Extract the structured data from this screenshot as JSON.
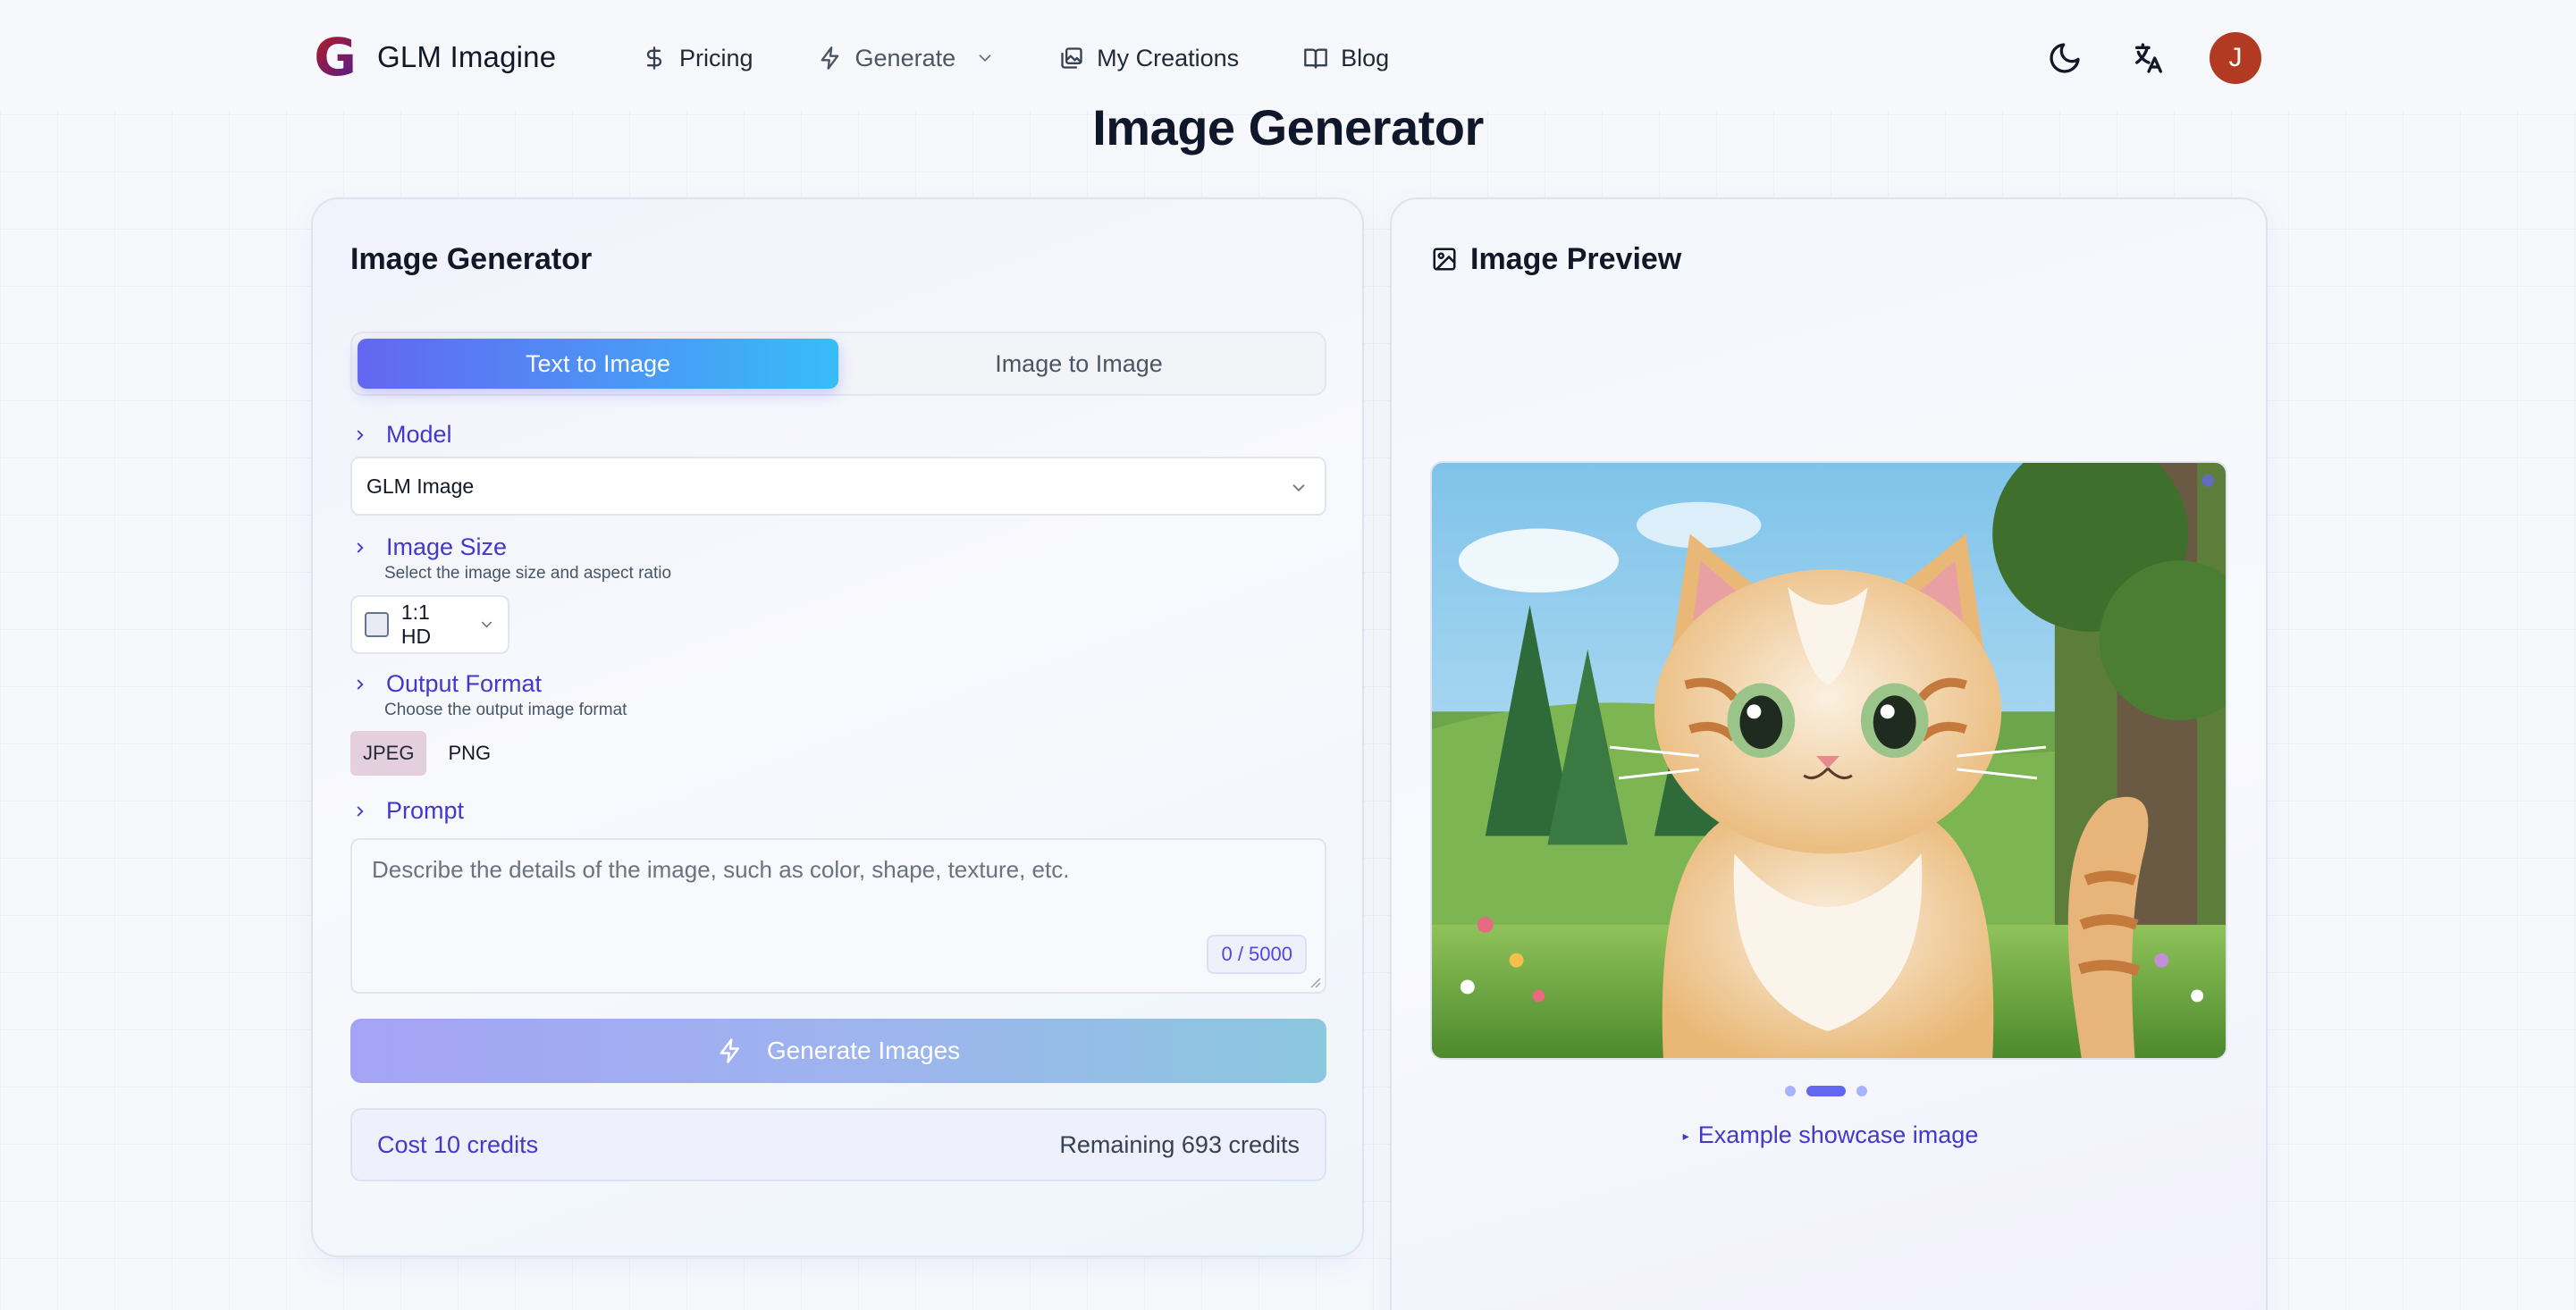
{
  "header": {
    "logo_letter": "G",
    "app_name": "GLM Imagine",
    "nav": [
      {
        "label": "Pricing",
        "icon": "dollar-icon"
      },
      {
        "label": "Generate",
        "icon": "lightning-icon"
      },
      {
        "label": "My Creations",
        "icon": "gallery-icon"
      },
      {
        "label": "Blog",
        "icon": "book-icon"
      }
    ],
    "avatar_initial": "J",
    "icons": {
      "theme": "moon-icon",
      "language": "translate-icon"
    }
  },
  "page_title": "Image Generator",
  "generator": {
    "title": "Image Generator",
    "tabs": [
      "Text to Image",
      "Image to Image"
    ],
    "active_tab": "Text to Image",
    "model": {
      "label": "Model",
      "value": "GLM Image"
    },
    "image_size": {
      "label": "Image Size",
      "description": "Select the image size and aspect ratio",
      "value": "1:1 HD"
    },
    "output_format": {
      "label": "Output Format",
      "description": "Choose the output image format",
      "options": [
        "JPEG",
        "PNG"
      ],
      "selected": "JPEG"
    },
    "prompt": {
      "label": "Prompt",
      "placeholder": "Describe the details of the image, such as color, shape, texture, etc.",
      "value": "",
      "counter": "0 / 5000"
    },
    "generate_button": "Generate Images",
    "cost": "Cost 10 credits",
    "remaining": "Remaining 693 credits"
  },
  "preview": {
    "title": "Image Preview",
    "caption": "Example showcase image",
    "carousel": {
      "count": 3,
      "active_index": 1
    }
  },
  "colors": {
    "accent": "#4338ca",
    "tab_gradient_start": "#6366f1",
    "tab_gradient_end": "#38bdf8",
    "avatar": "#b23a22"
  }
}
